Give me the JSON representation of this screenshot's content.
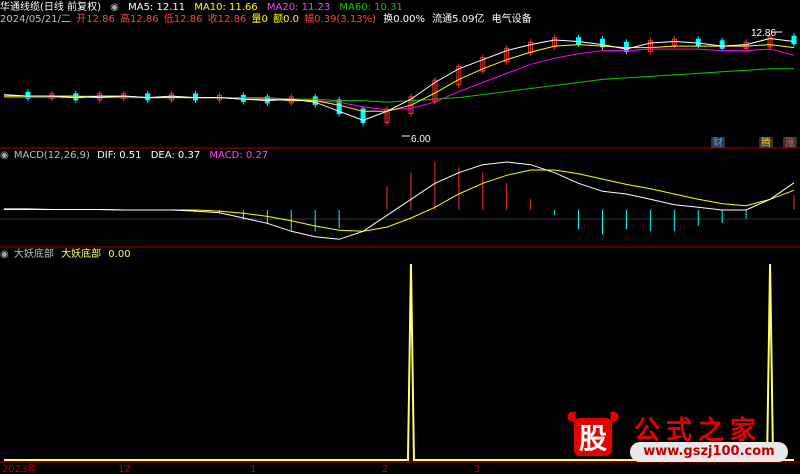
{
  "top_bar": {
    "title": "华通线缆(日线 前复权)",
    "ma": [
      {
        "label": "MA5: 12.11",
        "color": "#ffffff"
      },
      {
        "label": "MA10: 11.66",
        "color": "#ffff00"
      },
      {
        "label": "MA20: 11.23",
        "color": "#ff00ff"
      },
      {
        "label": "MA60: 10.31",
        "color": "#00cc00"
      }
    ]
  },
  "info_bar": {
    "date": "2024/05/21/二",
    "open": "开12.86",
    "high": "高12.86",
    "low": "低12.86",
    "close": "收12.86",
    "volume": "量0",
    "amount": "额0.0",
    "change": "幅0.39(3.13%)",
    "turnover": "换0.00%",
    "float": "流通5.09亿",
    "sector": "电气设备"
  },
  "macd_header": {
    "name": "MACD(12,26,9)",
    "dif": "DIF: 0.51",
    "dea": "DEA: 0.37",
    "macd": "MACD: 0.27"
  },
  "indicator_header": {
    "name": "大妖底部",
    "label": "大妖底部",
    "value": "0.00"
  },
  "price_labels": {
    "high": "12.86",
    "low": "6.00"
  },
  "badges": [
    "财",
    "腾",
    "涨"
  ],
  "axis_labels": [
    "2023年",
    "12",
    "1",
    "2",
    "3"
  ],
  "watermark": {
    "glyph": "股",
    "title": "公式之家",
    "url": "www.gszj100.com"
  },
  "colors": {
    "up": "#ff3333",
    "down": "#00ffff",
    "ma5": "#ffffff",
    "ma10": "#ffff00",
    "ma20": "#ff00ff",
    "ma60": "#00cc00",
    "signal": "#ffff66",
    "divider": "#b00000"
  },
  "chart_data": {
    "type": "line",
    "x": [
      0,
      5,
      10,
      15,
      20,
      25,
      30,
      35,
      40,
      45,
      50,
      55,
      60,
      65,
      70,
      75,
      80,
      85,
      90,
      95,
      100,
      105,
      110,
      115,
      120,
      125,
      130,
      135,
      140,
      145,
      150,
      155,
      160,
      165
    ],
    "series": [
      {
        "name": "MA5",
        "values": [
          8.6,
          8.5,
          8.5,
          8.4,
          8.5,
          8.5,
          8.4,
          8.5,
          8.4,
          8.4,
          8.3,
          8.2,
          8.3,
          8.1,
          7.5,
          6.9,
          7.5,
          8.3,
          9.4,
          10.3,
          10.9,
          11.5,
          11.9,
          12.2,
          12.1,
          11.9,
          11.6,
          12.0,
          12.1,
          12.0,
          11.8,
          11.9,
          12.3,
          12.1
        ]
      },
      {
        "name": "MA10",
        "values": [
          8.5,
          8.5,
          8.5,
          8.5,
          8.4,
          8.5,
          8.4,
          8.4,
          8.4,
          8.4,
          8.3,
          8.3,
          8.2,
          8.2,
          7.9,
          7.5,
          7.5,
          7.9,
          8.7,
          9.6,
          10.3,
          10.9,
          11.4,
          11.8,
          11.9,
          11.8,
          11.7,
          11.7,
          11.8,
          11.8,
          11.8,
          11.8,
          11.9,
          11.7
        ]
      },
      {
        "name": "MA20",
        "values": [
          8.4,
          8.4,
          8.4,
          8.4,
          8.4,
          8.4,
          8.4,
          8.4,
          8.4,
          8.4,
          8.3,
          8.3,
          8.3,
          8.2,
          8.1,
          7.8,
          7.6,
          7.7,
          8.1,
          8.8,
          9.4,
          10.0,
          10.6,
          11.0,
          11.3,
          11.5,
          11.5,
          11.6,
          11.6,
          11.6,
          11.5,
          11.5,
          11.6,
          11.2
        ]
      },
      {
        "name": "MA60",
        "values": [
          8.5,
          8.5,
          8.5,
          8.5,
          8.5,
          8.4,
          8.4,
          8.4,
          8.4,
          8.4,
          8.4,
          8.4,
          8.3,
          8.3,
          8.2,
          8.2,
          8.1,
          8.2,
          8.3,
          8.4,
          8.6,
          8.8,
          9.0,
          9.2,
          9.4,
          9.6,
          9.7,
          9.8,
          9.9,
          10.0,
          10.1,
          10.2,
          10.3,
          10.3
        ]
      },
      {
        "name": "DIF",
        "values": [
          0.02,
          0.02,
          0.01,
          0.01,
          0.01,
          0.0,
          0.0,
          0.0,
          -0.02,
          -0.05,
          -0.15,
          -0.25,
          -0.4,
          -0.5,
          -0.55,
          -0.4,
          -0.1,
          0.2,
          0.5,
          0.7,
          0.85,
          0.9,
          0.85,
          0.7,
          0.5,
          0.35,
          0.3,
          0.2,
          0.1,
          0.05,
          0.0,
          0.0,
          0.2,
          0.51
        ]
      },
      {
        "name": "DEA",
        "values": [
          0.01,
          0.01,
          0.01,
          0.01,
          0.01,
          0.0,
          0.0,
          0.0,
          0.0,
          -0.02,
          -0.06,
          -0.12,
          -0.2,
          -0.3,
          -0.38,
          -0.4,
          -0.32,
          -0.15,
          0.05,
          0.3,
          0.5,
          0.65,
          0.75,
          0.75,
          0.68,
          0.58,
          0.48,
          0.4,
          0.3,
          0.2,
          0.12,
          0.08,
          0.2,
          0.37
        ]
      },
      {
        "name": "大妖底部",
        "values": [
          0,
          0,
          0,
          0,
          0,
          0,
          0,
          0,
          0,
          0,
          0,
          0,
          0,
          0,
          0,
          0,
          0,
          1,
          0,
          0,
          0,
          0,
          0,
          0,
          0,
          0,
          0,
          0,
          0,
          0,
          0,
          0,
          1,
          0
        ]
      }
    ],
    "ylim_price": [
      6.0,
      12.86
    ],
    "ylim_macd": [
      -0.6,
      0.9
    ],
    "ylim_signal": [
      0,
      1
    ]
  }
}
